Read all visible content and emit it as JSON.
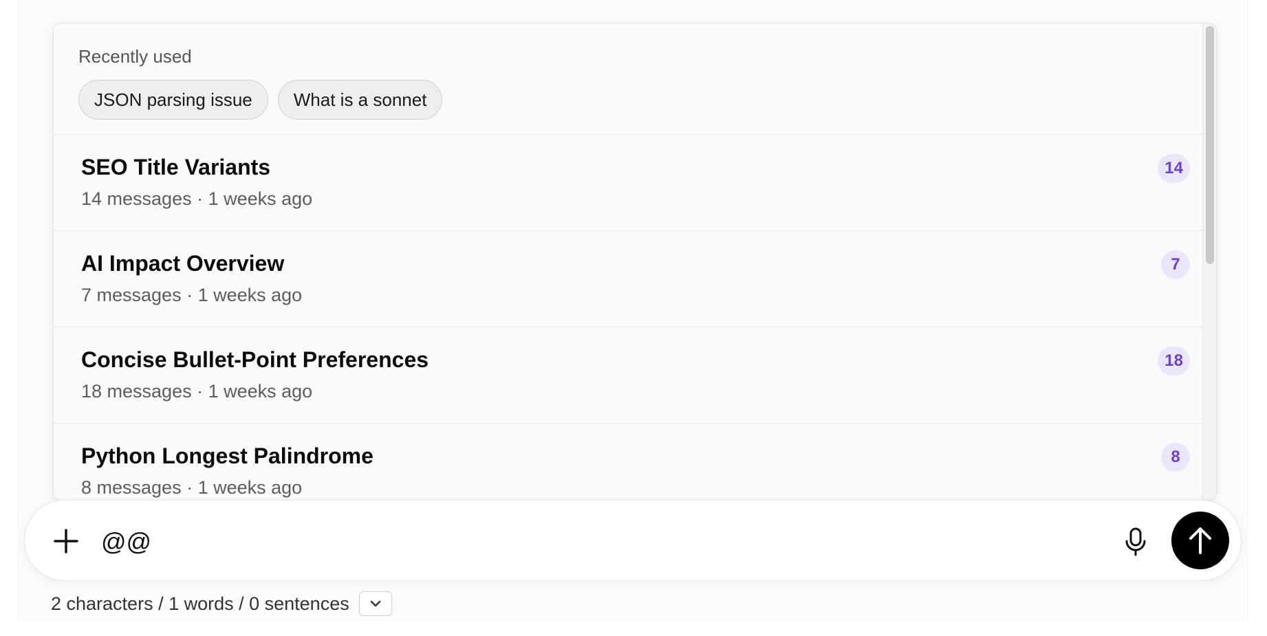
{
  "recent": {
    "title": "Recently used",
    "chips": [
      {
        "label": "JSON parsing issue"
      },
      {
        "label": "What is a sonnet"
      }
    ]
  },
  "conversations": [
    {
      "title": "SEO Title Variants",
      "meta": "14 messages · 1 weeks ago",
      "count": "14"
    },
    {
      "title": "AI Impact Overview",
      "meta": "7 messages · 1 weeks ago",
      "count": "7"
    },
    {
      "title": "Concise Bullet-Point Preferences",
      "meta": "18 messages · 1 weeks ago",
      "count": "18"
    },
    {
      "title": "Python Longest Palindrome",
      "meta": "8 messages · 1 weeks ago",
      "count": "8"
    }
  ],
  "composer": {
    "value": "@@",
    "plus_icon": "plus-icon",
    "mic_icon": "microphone-icon",
    "send_icon": "arrow-up-icon"
  },
  "counter": {
    "text": "2 characters / 1 words / 0 sentences",
    "toggle_icon": "chevron-down-icon"
  },
  "colors": {
    "badge_bg": "#ebe7fa",
    "badge_text": "#6d3fd6",
    "send_bg": "#000000"
  }
}
